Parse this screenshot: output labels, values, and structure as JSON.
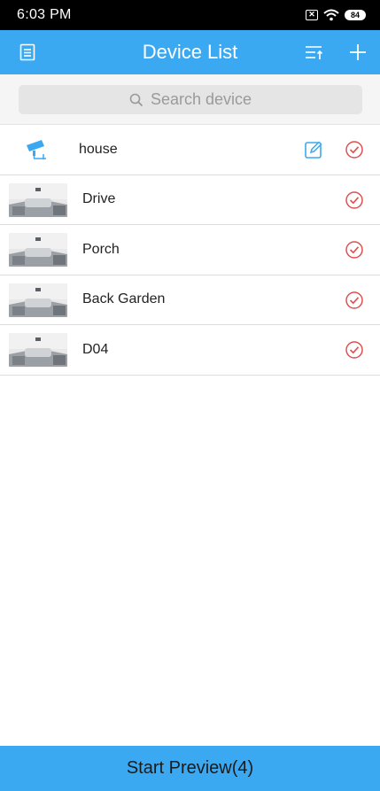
{
  "status_bar": {
    "time": "6:03 PM",
    "battery": "84"
  },
  "app_bar": {
    "title": "Device List"
  },
  "search": {
    "placeholder": "Search device"
  },
  "devices": [
    {
      "name": "house",
      "type": "group",
      "checked": true
    },
    {
      "name": "Drive",
      "type": "camera",
      "checked": true
    },
    {
      "name": "Porch",
      "type": "camera",
      "checked": true
    },
    {
      "name": "Back Garden",
      "type": "camera",
      "checked": true
    },
    {
      "name": "D04",
      "type": "camera",
      "checked": true
    }
  ],
  "footer": {
    "start_label": "Start Preview(4)"
  },
  "colors": {
    "accent": "#3ba9f2",
    "check": "#e05050"
  },
  "icons": [
    "menu-icon",
    "sort-icon",
    "plus-icon",
    "search-icon",
    "camera-icon",
    "edit-icon",
    "check-circle-icon",
    "wifi-icon"
  ]
}
